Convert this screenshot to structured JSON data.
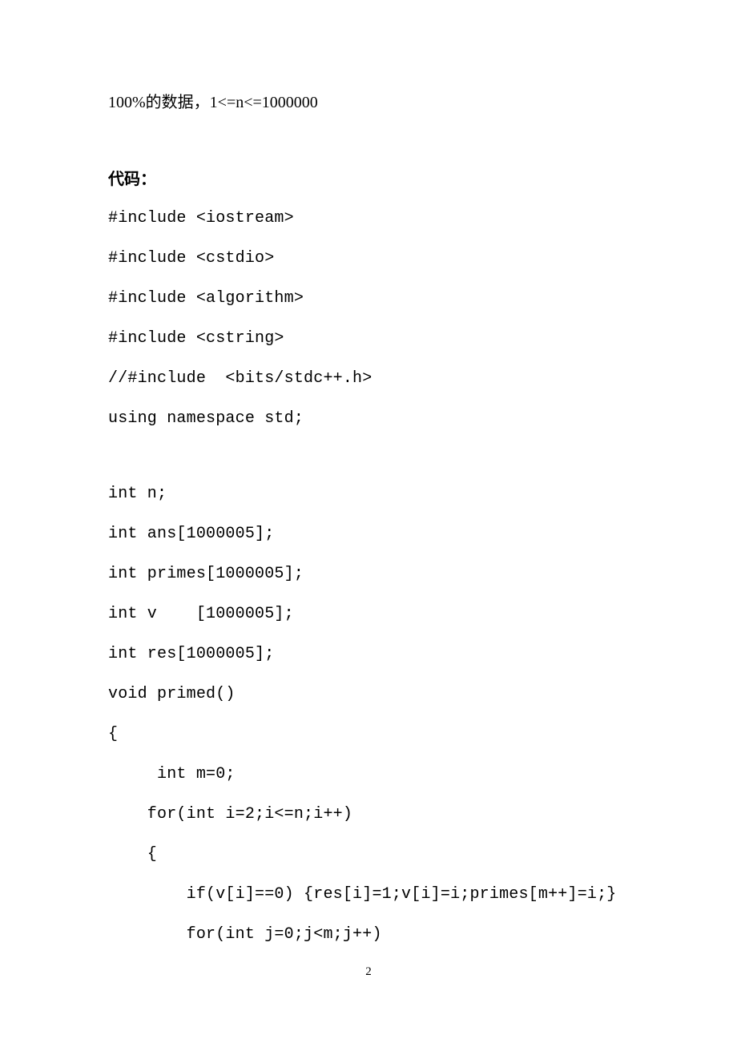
{
  "data_range": "100%的数据，1<=n<=1000000",
  "code_heading": "代码：",
  "code": {
    "l1": "#include <iostream>",
    "l2": "#include <cstdio>",
    "l3": "#include <algorithm>",
    "l4": "#include <cstring>",
    "l5": "//#include  <bits/stdc++.h>",
    "l6": "using namespace std;",
    "l7": "int n;",
    "l8": "int ans[1000005];",
    "l9": "int primes[1000005];",
    "l10": "int v    [1000005];",
    "l11": "int res[1000005];",
    "l12": "void primed()",
    "l13": "{",
    "l14": "     int m=0;",
    "l15": "    for(int i=2;i<=n;i++)",
    "l16": "    {",
    "l17": "        if(v[i]==0) {res[i]=1;v[i]=i;primes[m++]=i;}",
    "l18": "        for(int j=0;j<m;j++)"
  },
  "page_number": "2"
}
